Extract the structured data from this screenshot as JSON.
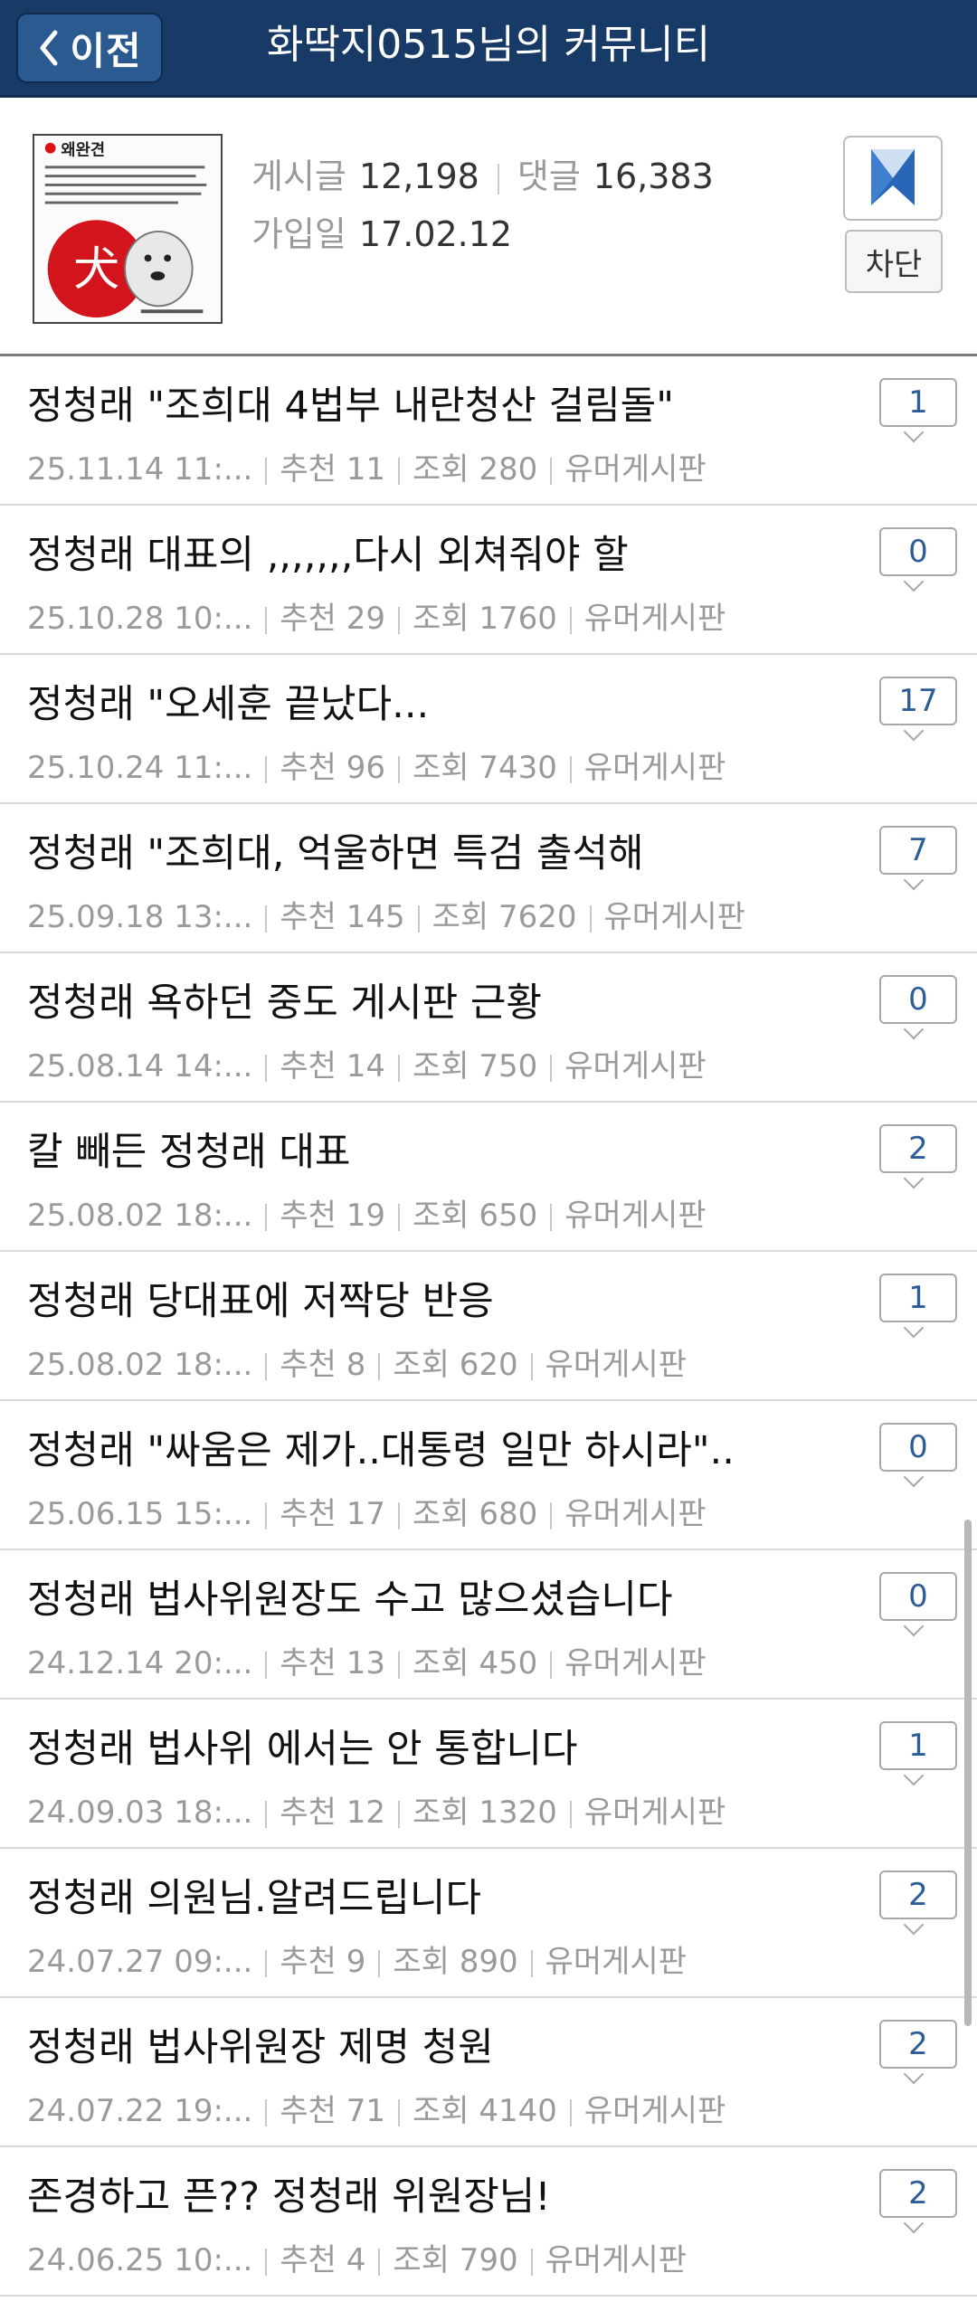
{
  "header": {
    "back_label": "이전",
    "title": "화딱지0515님의 커뮤니티"
  },
  "profile": {
    "posts_label": "게시글",
    "posts_value": "12,198",
    "comments_label": "댓글",
    "comments_value": "16,383",
    "joined_label": "가입일",
    "joined_value": "17.02.12",
    "block_label": "차단",
    "avatar_title": "왜완견",
    "avatar_char": "犬"
  },
  "posts": [
    {
      "title": "정청래 \"조희대 4법부 내란청산 걸림돌\"",
      "date": "25.11.14 11:...",
      "rec": "추천 11",
      "views": "조회 280",
      "board": "유머게시판",
      "comments": "1"
    },
    {
      "title": "정청래 대표의 ,,,,,,,다시 외쳐줘야 할",
      "date": "25.10.28 10:...",
      "rec": "추천 29",
      "views": "조회 1760",
      "board": "유머게시판",
      "comments": "0"
    },
    {
      "title": "정청래 \"오세훈 끝났다...",
      "date": "25.10.24 11:...",
      "rec": "추천 96",
      "views": "조회 7430",
      "board": "유머게시판",
      "comments": "17"
    },
    {
      "title": "정청래 \"조희대, 억울하면 특검 출석해",
      "date": "25.09.18 13:...",
      "rec": "추천 145",
      "views": "조회 7620",
      "board": "유머게시판",
      "comments": "7"
    },
    {
      "title": "정청래 욕하던 중도 게시판 근황",
      "date": "25.08.14 14:...",
      "rec": "추천 14",
      "views": "조회 750",
      "board": "유머게시판",
      "comments": "0"
    },
    {
      "title": "칼 빼든 정청래 대표",
      "date": "25.08.02 18:...",
      "rec": "추천 19",
      "views": "조회 650",
      "board": "유머게시판",
      "comments": "2"
    },
    {
      "title": "정청래 당대표에 저짝당 반응",
      "date": "25.08.02 18:...",
      "rec": "추천 8",
      "views": "조회 620",
      "board": "유머게시판",
      "comments": "1"
    },
    {
      "title": "정청래 \"싸움은 제가..대통령 일만 하시라\"..",
      "date": "25.06.15 15:...",
      "rec": "추천 17",
      "views": "조회 680",
      "board": "유머게시판",
      "comments": "0"
    },
    {
      "title": "정청래 법사위원장도 수고 많으셨습니다",
      "date": "24.12.14 20:...",
      "rec": "추천 13",
      "views": "조회 450",
      "board": "유머게시판",
      "comments": "0"
    },
    {
      "title": "정청래 법사위 에서는 안 통합니다",
      "date": "24.09.03 18:...",
      "rec": "추천 12",
      "views": "조회 1320",
      "board": "유머게시판",
      "comments": "1"
    },
    {
      "title": "정청래 의원님.알려드립니다",
      "date": "24.07.27 09:...",
      "rec": "추천 9",
      "views": "조회 890",
      "board": "유머게시판",
      "comments": "2"
    },
    {
      "title": "정청래 법사위원장 제명 청원",
      "date": "24.07.22 19:...",
      "rec": "추천 71",
      "views": "조회 4140",
      "board": "유머게시판",
      "comments": "2"
    },
    {
      "title": "존경하고 픈?? 정청래 위원장님!",
      "date": "24.06.25 10:...",
      "rec": "추천 4",
      "views": "조회 790",
      "board": "유머게시판",
      "comments": "2"
    }
  ],
  "colors": {
    "header_bg": "#173a66",
    "comment_count": "#2c5d98",
    "meta_text": "#9a9a9a"
  }
}
